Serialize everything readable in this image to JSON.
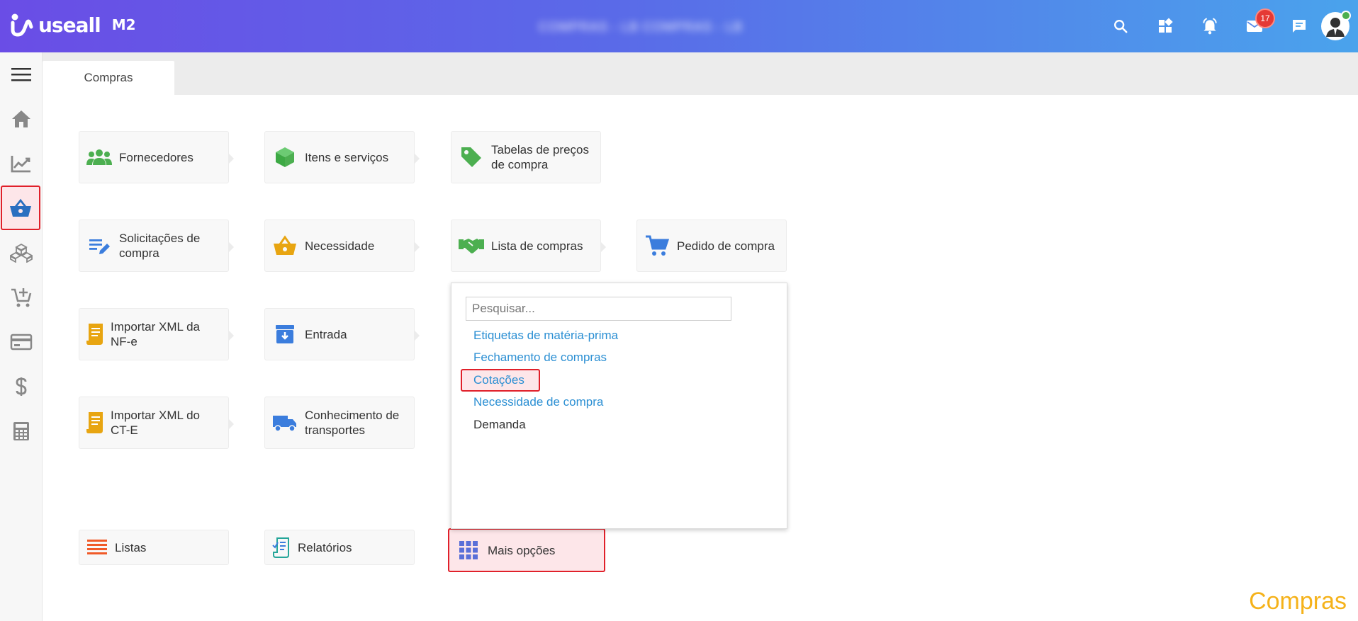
{
  "header": {
    "brand": "useall",
    "version": "M2",
    "company": "COMPRAS - LB  COMPRAS - LB",
    "notifications_count": "17"
  },
  "sidebar": {
    "items": [
      "menu",
      "home",
      "dashboard",
      "compras",
      "estoque",
      "vendas",
      "financeiro",
      "fiscal",
      "calculadora"
    ]
  },
  "tabs": [
    {
      "label": "Compras"
    }
  ],
  "tiles": {
    "fornecedores": "Fornecedores",
    "itens_servicos": "Itens e serviços",
    "tabelas_precos": "Tabelas de preços de compra",
    "solicitacoes": "Solicitações de compra",
    "necessidade": "Necessidade",
    "lista_compras": "Lista de compras",
    "pedido_compra": "Pedido de compra",
    "importar_nfe": "Importar XML da NF-e",
    "entrada": "Entrada",
    "importar_cte": "Importar XML do CT-E",
    "conhecimento": "Conhecimento de transportes"
  },
  "bottom": {
    "listas": "Listas",
    "relatorios": "Relatórios",
    "mais_opcoes": "Mais opções"
  },
  "dropdown": {
    "search_placeholder": "Pesquisar...",
    "items": [
      "Etiquetas de matéria-prima",
      "Fechamento de compras",
      "Cotações",
      "Necessidade de compra",
      "Demanda"
    ]
  },
  "watermark": "Compras",
  "colors": {
    "accent_link": "#2b8fd3",
    "highlight_border": "#e0202a",
    "watermark": "#f5b21a"
  }
}
